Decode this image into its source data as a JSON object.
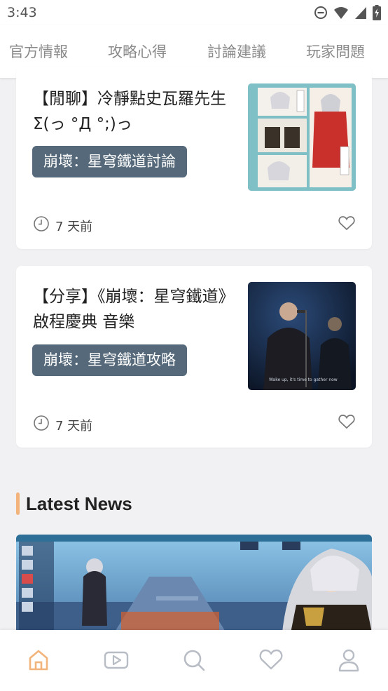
{
  "status_bar": {
    "time": "3:43",
    "icons": [
      "do-not-disturb-icon",
      "wifi-icon",
      "cell-signal-icon",
      "battery-charging-icon"
    ]
  },
  "top_tabs": [
    {
      "label": "官方情報"
    },
    {
      "label": "攻略心得"
    },
    {
      "label": "討論建議"
    },
    {
      "label": "玩家問題"
    }
  ],
  "posts": [
    {
      "title": "【閒聊】冷靜點史瓦羅先生Σ(っ °Д °;)っ",
      "tag": "崩壞：星穹鐵道討論",
      "time": "7 天前",
      "thumbnail": "manga-comic-thumbnail"
    },
    {
      "title": "【分享】《崩壞：星穹鐵道》啟程慶典 音樂",
      "tag": "崩壞：星穹鐵道攻略",
      "time": "7 天前",
      "thumbnail": "concert-singer-thumbnail",
      "thumbnail_caption": "Wake up, it's time to gather now"
    }
  ],
  "latest_news": {
    "heading": "Latest News",
    "banner": "game-screenshot-banner"
  },
  "bottom_nav": [
    {
      "icon": "home-icon",
      "active": true
    },
    {
      "icon": "video-icon",
      "active": false
    },
    {
      "icon": "search-icon",
      "active": false
    },
    {
      "icon": "heart-icon",
      "active": false
    },
    {
      "icon": "profile-icon",
      "active": false
    }
  ],
  "colors": {
    "accent": "#f2b47a",
    "tag_bg": "#55697a",
    "page_bg": "#f1f1f3",
    "nav_inactive": "#b8bcc4"
  }
}
